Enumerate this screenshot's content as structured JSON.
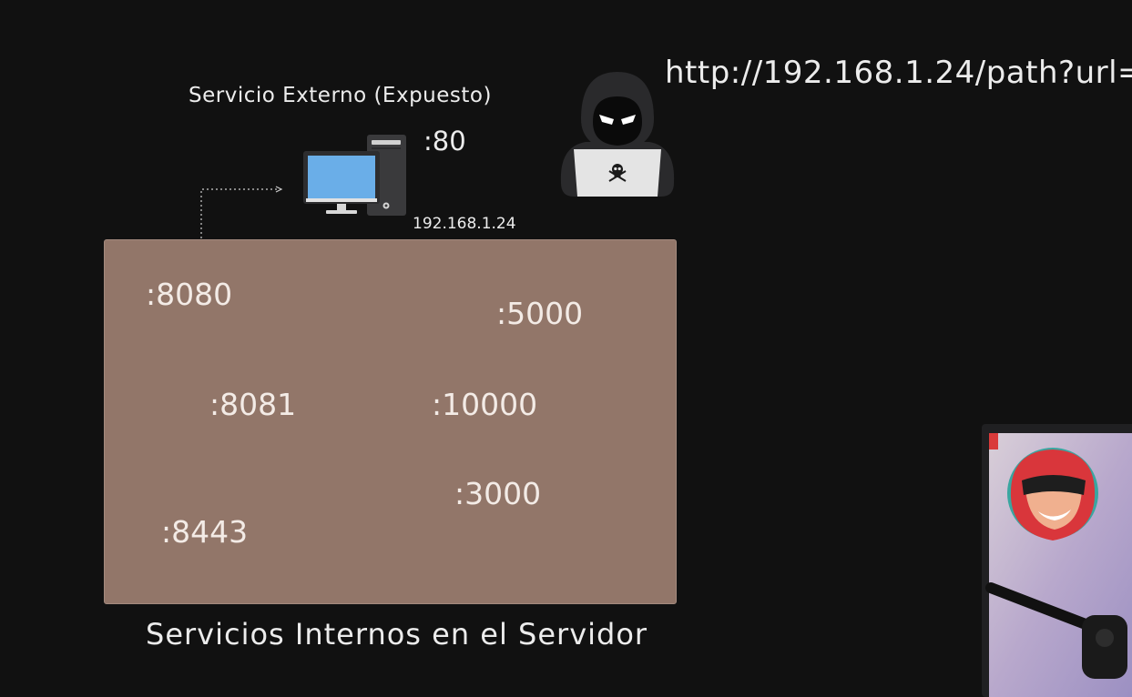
{
  "external_service": {
    "title": "Servicio Externo (Expuesto)",
    "port": ":80",
    "ip": "192.168.1.24"
  },
  "attacker": {
    "url": "http://192.168.1.24/path?url="
  },
  "internal_services": {
    "title": "Servicios Internos en el Servidor",
    "ports": [
      ":8080",
      ":5000",
      ":8081",
      ":10000",
      ":3000",
      ":8443"
    ]
  },
  "colors": {
    "background": "#111111",
    "internal_box": "#927669",
    "text": "#ececec",
    "monitor_screen": "#6aaee8",
    "laptop": "#e4e4e4"
  }
}
